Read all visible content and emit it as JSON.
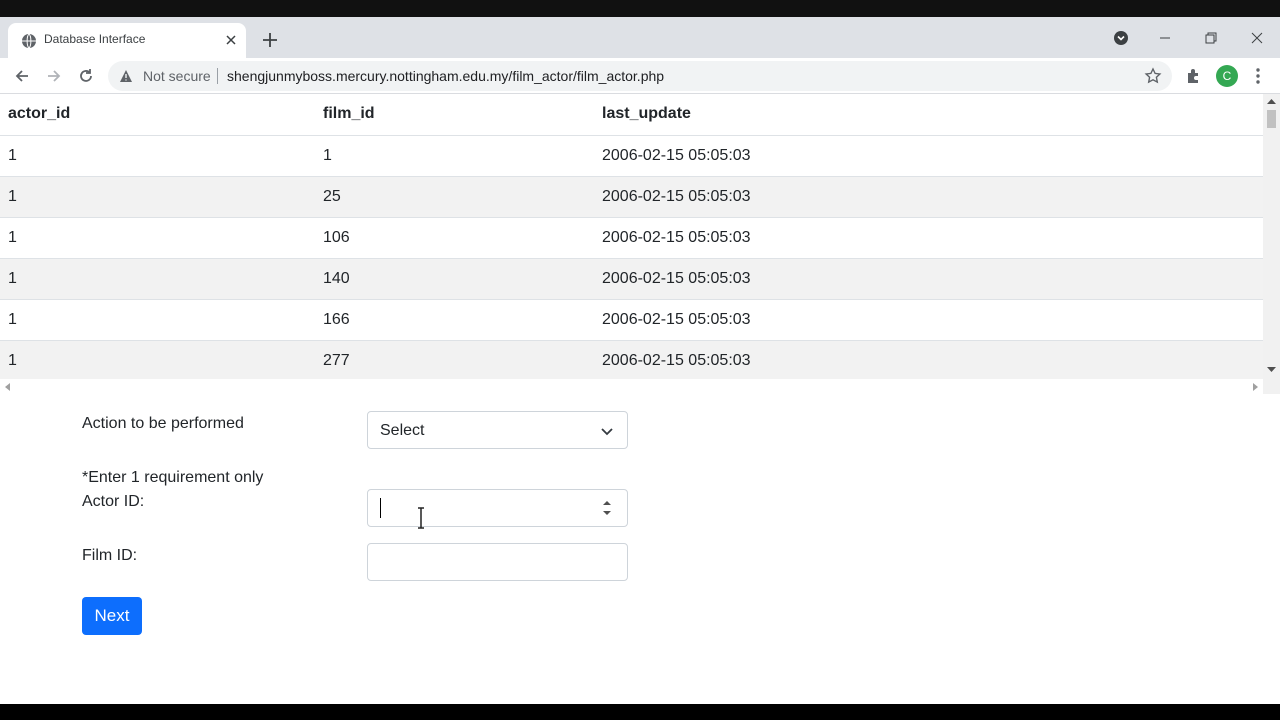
{
  "browser": {
    "tab_title": "Database Interface",
    "security_label": "Not secure",
    "url": "shengjunmyboss.mercury.nottingham.edu.my/film_actor/film_actor.php",
    "profile_initial": "C"
  },
  "table": {
    "columns": [
      "actor_id",
      "film_id",
      "last_update"
    ],
    "rows": [
      [
        "1",
        "1",
        "2006-02-15 05:05:03"
      ],
      [
        "1",
        "25",
        "2006-02-15 05:05:03"
      ],
      [
        "1",
        "106",
        "2006-02-15 05:05:03"
      ],
      [
        "1",
        "140",
        "2006-02-15 05:05:03"
      ],
      [
        "1",
        "166",
        "2006-02-15 05:05:03"
      ],
      [
        "1",
        "277",
        "2006-02-15 05:05:03"
      ]
    ]
  },
  "form": {
    "action_label": "Action to be performed",
    "action_selected": "Select",
    "requirement_note": "*Enter 1 requirement only",
    "actor_id_label": "Actor ID:",
    "actor_id_value": "",
    "film_id_label": "Film ID:",
    "film_id_value": "",
    "next_label": "Next"
  },
  "colors": {
    "primary_button": "#0d6efd",
    "tabstrip": "#dee1e6",
    "profile": "#34a853"
  }
}
